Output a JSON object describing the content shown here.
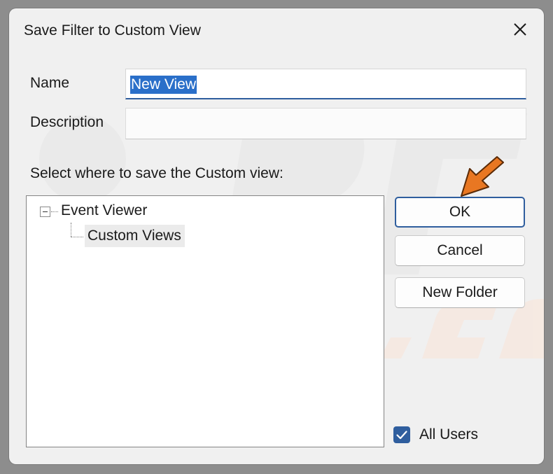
{
  "dialog": {
    "title": "Save Filter to Custom View"
  },
  "form": {
    "name_label": "Name",
    "name_value": "New View",
    "description_label": "Description",
    "description_value": "",
    "location_label": "Select where to save the Custom view:"
  },
  "tree": {
    "root_label": "Event Viewer",
    "child_label": "Custom Views"
  },
  "buttons": {
    "ok_label": "OK",
    "cancel_label": "Cancel",
    "new_folder_label": "New Folder"
  },
  "options": {
    "all_users_label": "All Users",
    "all_users_checked": true
  },
  "icons": {
    "close": "close-icon",
    "check": "checkmark-icon",
    "expander": "collapse-minus-icon",
    "pointer": "arrow-pointer-icon"
  },
  "colors": {
    "accent": "#2f5e9e",
    "selection": "#2a6fc9",
    "arrow": "#e87722"
  }
}
